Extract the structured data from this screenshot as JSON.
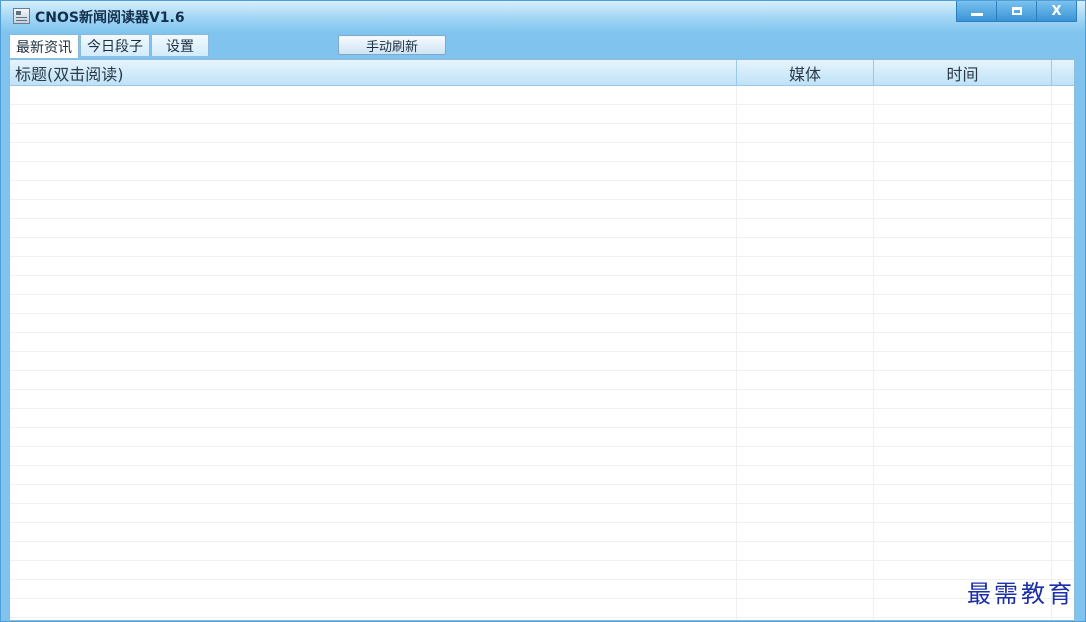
{
  "window": {
    "title": "CNOS新闻阅读器V1.6",
    "controls": [
      "minimize",
      "maximize",
      "close"
    ],
    "close_glyph": "X"
  },
  "tabs": [
    {
      "label": "最新资讯",
      "active": true
    },
    {
      "label": "今日段子",
      "active": false
    },
    {
      "label": "设置",
      "active": false
    }
  ],
  "toolbar": {
    "refresh_label": "手动刷新"
  },
  "list": {
    "columns": [
      "标题(双击阅读)",
      "媒体",
      "时间"
    ],
    "rows": []
  },
  "watermark": "最需教育",
  "colors": {
    "titlebar": "#7ec4ef",
    "accent": "#3a94d6",
    "watermark": "#1a2fa8"
  }
}
